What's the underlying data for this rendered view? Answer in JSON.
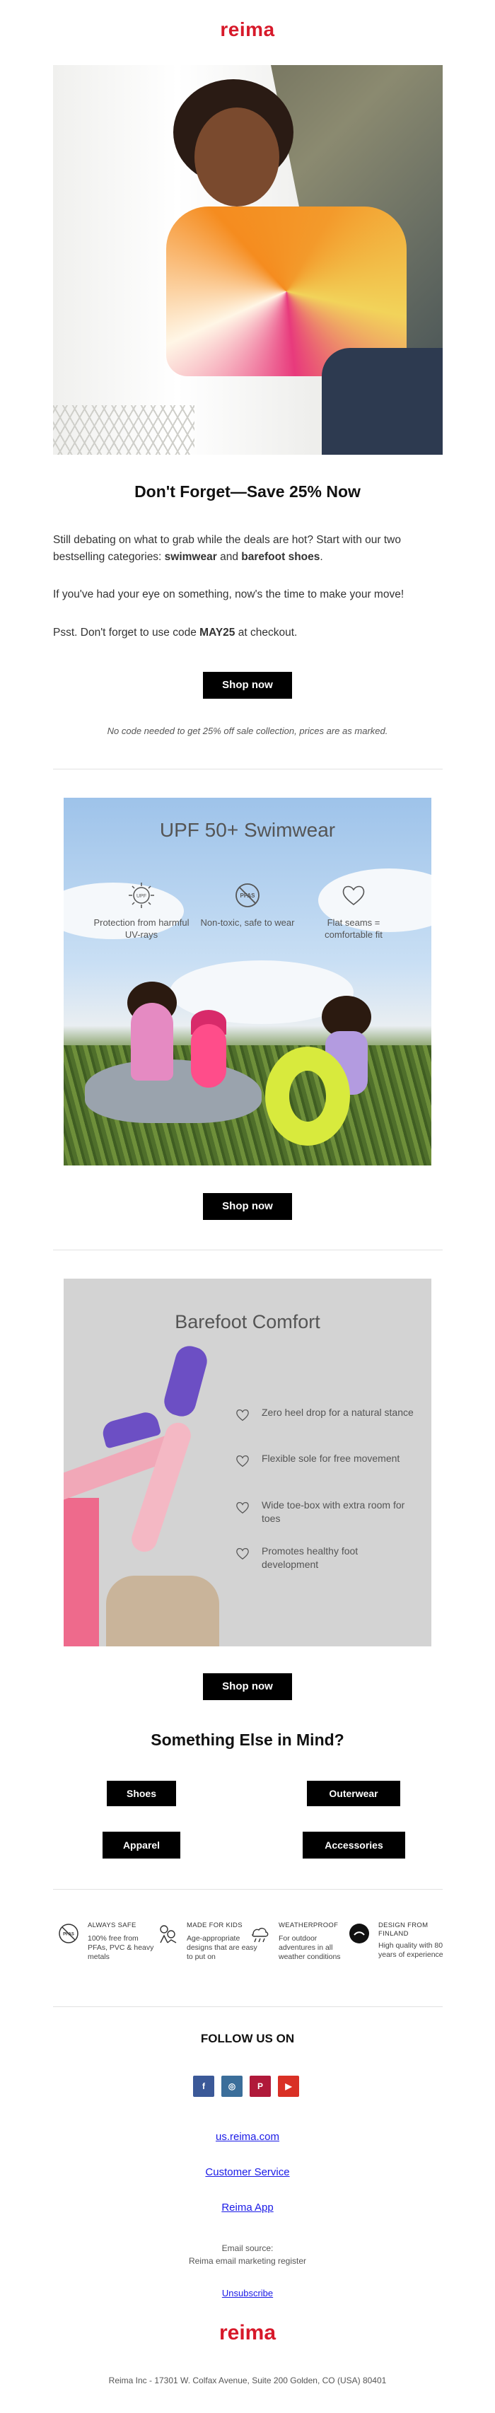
{
  "brand": {
    "logo": "reima",
    "color": "#d7192a"
  },
  "hero": {
    "alt_icon": "child-in-hammock-photo"
  },
  "intro": {
    "headline": "Don't Forget—Save 25% Now",
    "p1_a": "Still debating on what to grab while the deals are hot? Start with our two bestselling categories: ",
    "p1_b": "swimwear",
    "p1_c": " and ",
    "p1_d": "barefoot shoes",
    "p1_e": ".",
    "p2": "If you've had your eye on something, now's the time to make your move!",
    "p3_a": "Psst. Don't forget to use code ",
    "p3_b": "MAY25",
    "p3_c": " at checkout.",
    "button": "Shop now",
    "note": "No code needed to get 25% off sale collection, prices are as marked."
  },
  "swimwear": {
    "title": "UPF 50+ Swimwear",
    "features": [
      {
        "icon": "sun-upf-icon",
        "text": "Protection from harmful UV-rays"
      },
      {
        "icon": "pfas-free-icon",
        "text": "Non-toxic, safe to wear"
      },
      {
        "icon": "heart-icon",
        "text": "Flat seams = comfortable fit"
      }
    ],
    "button": "Shop now"
  },
  "barefoot": {
    "title": "Barefoot Comfort",
    "items": [
      "Zero heel drop for a natural stance",
      "Flexible sole for free movement",
      "Wide toe-box with extra room for toes",
      "Promotes healthy foot development"
    ],
    "button": "Shop now"
  },
  "something_else": {
    "title": "Something Else in Mind?",
    "buttons": [
      "Shoes",
      "Outerwear",
      "Apparel",
      "Accessories"
    ]
  },
  "trust": [
    {
      "icon": "pfas-free-icon",
      "title": "ALWAYS SAFE",
      "text": "100% free from PFAs, PVC & heavy metals"
    },
    {
      "icon": "kids-icon",
      "title": "MADE FOR KIDS",
      "text": "Age-appropriate designs that are easy to put on"
    },
    {
      "icon": "weather-icon",
      "title": "WEATHERPROOF",
      "text": "For outdoor adventures in all weather conditions"
    },
    {
      "icon": "finland-icon",
      "title": "DESIGN FROM FINLAND",
      "text": "High quality with 80 years of experience"
    }
  ],
  "social": {
    "title": "FOLLOW US ON",
    "icons": [
      {
        "name": "facebook-icon",
        "glyph": "f",
        "color": "#3b5998"
      },
      {
        "name": "instagram-icon",
        "glyph": "◎",
        "color": "#3b6e9a"
      },
      {
        "name": "pinterest-icon",
        "glyph": "P",
        "color": "#b0193a"
      },
      {
        "name": "youtube-icon",
        "glyph": "▶",
        "color": "#d93025"
      }
    ]
  },
  "links": {
    "site": "us.reima.com",
    "service": "Customer Service",
    "app": "Reima App",
    "source_label": "Email source:",
    "source": "Reima email marketing register",
    "unsubscribe": "Unsubscribe"
  },
  "footer": {
    "logo": "reima",
    "address": "Reima Inc - 17301 W. Colfax Avenue, Suite 200 Golden, CO (USA) 80401"
  }
}
